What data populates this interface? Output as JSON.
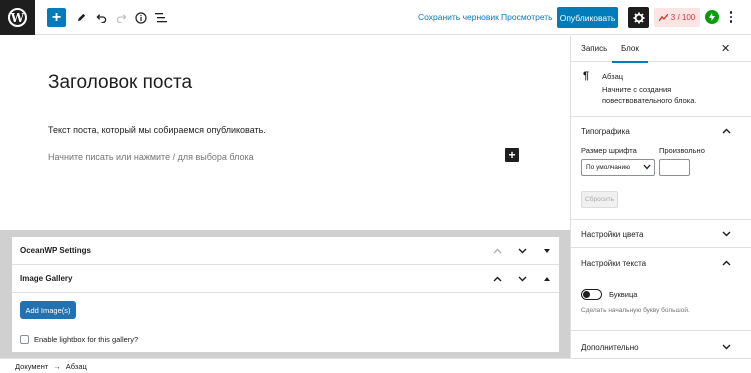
{
  "topbar": {
    "logo_letter": "W",
    "save_draft": "Сохранить черновик",
    "preview": "Просмотреть",
    "publish": "Опубликовать",
    "seo_score": "3 / 100",
    "icons": [
      "wordpress-logo",
      "plus-icon",
      "pencil-icon",
      "undo-icon",
      "redo-icon",
      "info-icon",
      "list-view-icon",
      "gear-icon",
      "seo-icon",
      "jetpack-icon",
      "more-vertical-icon"
    ]
  },
  "editor": {
    "title": "Заголовок поста",
    "paragraph": "Текст поста, который мы собираемся опубликовать.",
    "placeholder": "Начните писать или нажмите / для выбора блока"
  },
  "metaboxes": {
    "items": [
      {
        "title": "OceanWP Settings",
        "collapsed": true
      },
      {
        "title": "Image Gallery",
        "collapsed": false
      }
    ],
    "add_images": "Add Image(s)",
    "lightbox_label": "Enable lightbox for this gallery?"
  },
  "sidebar": {
    "tabs": [
      {
        "label": "Запись",
        "active": false
      },
      {
        "label": "Блок",
        "active": true
      }
    ],
    "close_glyph": "✕",
    "block": {
      "icon": "¶",
      "title": "Абзац",
      "description": "Начните с создания повествовательного блока."
    },
    "typography": {
      "title": "Типографика",
      "font_size_label": "Размер шрифта",
      "custom_label": "Произвольно",
      "select_value": "По умолчанию",
      "reset": "Сбросить"
    },
    "color_settings": "Настройки цвета",
    "text_settings": {
      "title": "Настройки текста",
      "dropcap_label": "Буквица",
      "dropcap_on": false,
      "help": "Сделать начальную букву большой."
    },
    "advanced": "Дополнительно"
  },
  "footer": {
    "breadcrumb": [
      "Документ",
      "→",
      "Абзац"
    ]
  },
  "colors": {
    "accent": "#007cba",
    "dark": "#1e1e1e",
    "seo_bad": "#d63638",
    "seo_bad_bg": "#fbe4e4",
    "jetpack": "#069e08",
    "metabox_bg": "#d0d0d0"
  }
}
